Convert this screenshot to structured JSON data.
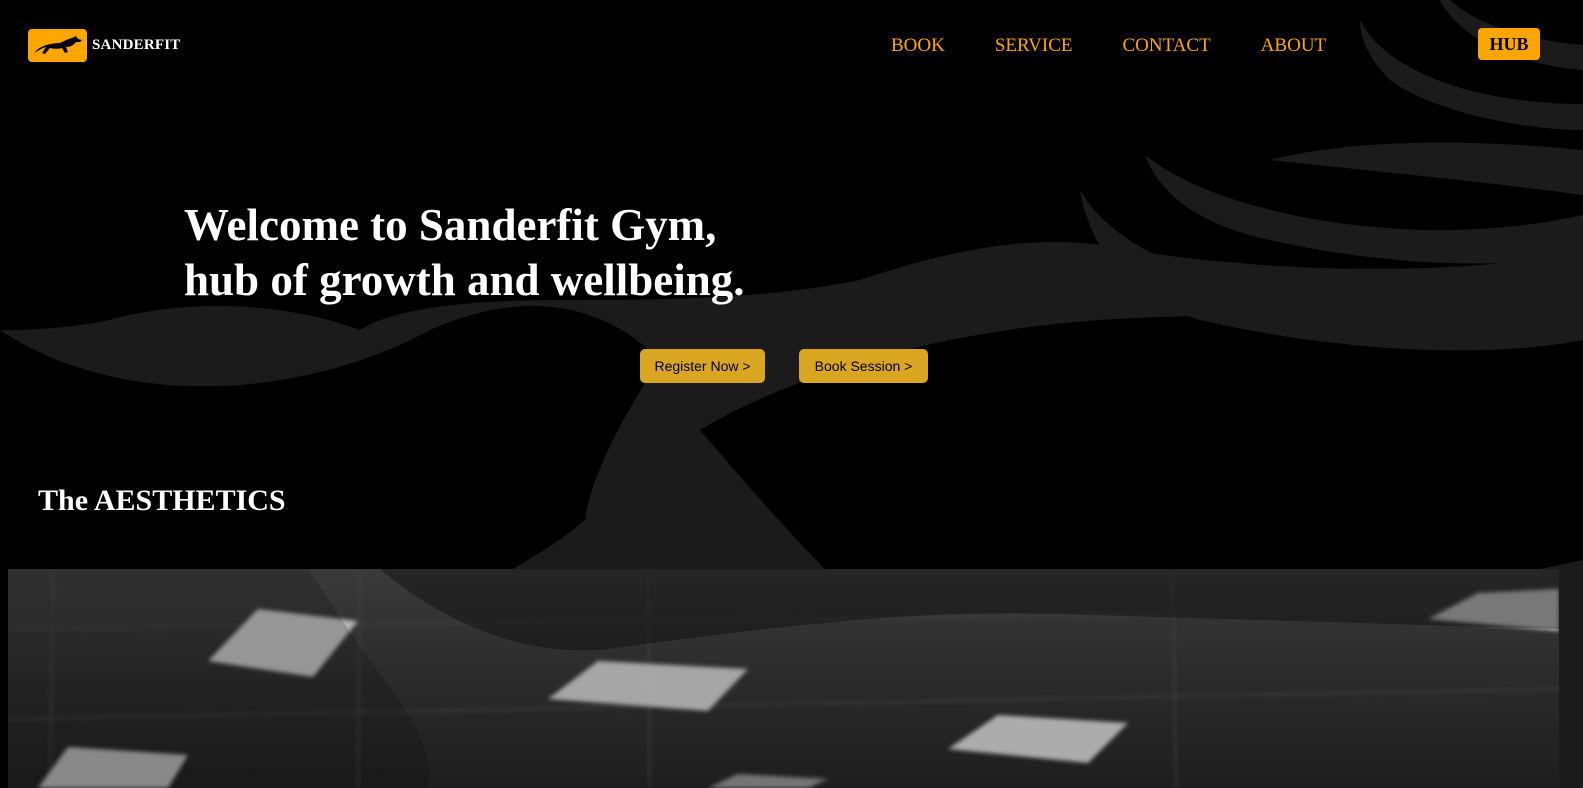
{
  "brand": {
    "name": "SANDERFIT",
    "logo_icon": "horse-icon",
    "accent_color": "#FFA500"
  },
  "nav": {
    "items": [
      "BOOK",
      "SERVICE",
      "CONTACT",
      "ABOUT"
    ],
    "hub_label": "HUB"
  },
  "hero": {
    "title_line1": "Welcome to Sanderfit Gym,",
    "title_line2": "hub of growth and wellbeing.",
    "register_label": "Register Now >",
    "book_label": "Book Session >",
    "button_color": "#DAA520"
  },
  "aesthetics": {
    "title": "The AESTHETICS"
  },
  "colors": {
    "background": "#000000",
    "swoosh": "#1b1b1b",
    "heading_text": "#ffffff"
  }
}
